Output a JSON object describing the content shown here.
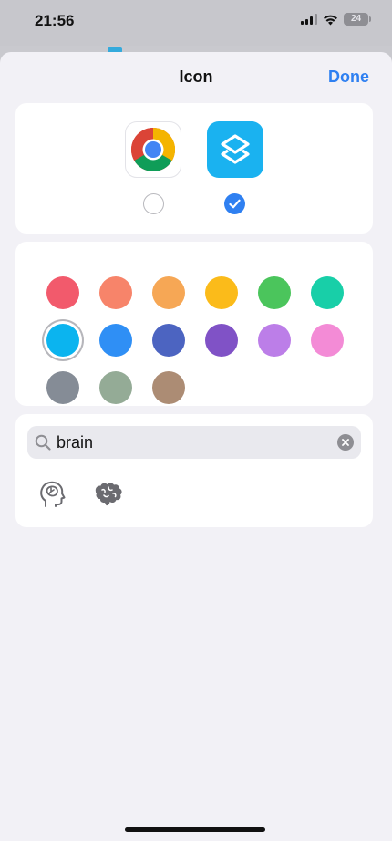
{
  "status_bar": {
    "time": "21:56",
    "battery_level": "24",
    "icons": [
      "signal-icon",
      "wifi-icon",
      "battery-icon"
    ]
  },
  "sheet": {
    "title": "Icon",
    "done_label": "Done",
    "accent_color": "#2f80f1"
  },
  "icon_options": [
    {
      "name": "chrome-icon",
      "selected": false
    },
    {
      "name": "shortcuts-icon",
      "selected": true
    }
  ],
  "colors": {
    "selected_index": 6,
    "swatches": [
      "#f25a6c",
      "#f7846a",
      "#f6a755",
      "#fbbb1a",
      "#4bc55c",
      "#18cfa8",
      "#0bb4ef",
      "#2f8ff5",
      "#4c64c1",
      "#8052c6",
      "#bc7ee8",
      "#f38bd6",
      "#858c96",
      "#94ab96",
      "#ac8c74"
    ]
  },
  "search": {
    "value": "brain",
    "results": [
      "head-brain-icon",
      "brain-icon"
    ]
  }
}
